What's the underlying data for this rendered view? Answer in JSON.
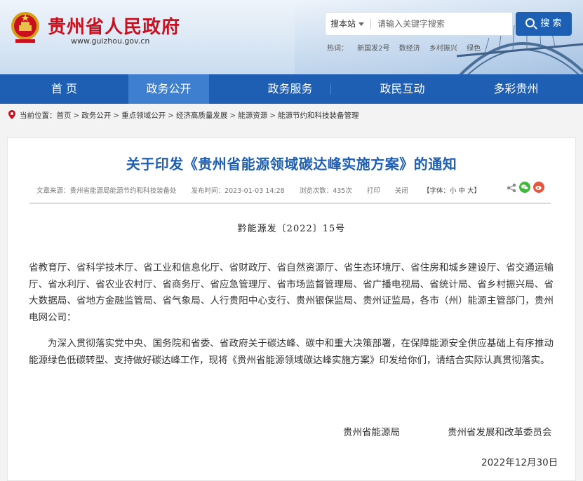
{
  "header": {
    "site_title": "贵州省人民政府",
    "site_url": "www.guizhou.gov.cn",
    "search": {
      "scope_label": "搜本站",
      "placeholder": "请输入关键字搜索",
      "button_label": "搜 索"
    },
    "hotwords": [
      "热词：",
      "新国发2号",
      "数经济",
      "乡村振兴",
      "绿色"
    ]
  },
  "nav": {
    "items": [
      {
        "label": "首 页"
      },
      {
        "label": "政务公开"
      },
      {
        "label": "政务服务"
      },
      {
        "label": "政民互动"
      },
      {
        "label": "多彩贵州"
      }
    ],
    "active_index": 1
  },
  "breadcrumb": {
    "prefix": "当前位置：",
    "items": [
      "首页",
      "政务公开",
      "重点领域公开",
      "经济高质量发展",
      "能源资源",
      "能源节约和科技装备管理"
    ],
    "separator": ">"
  },
  "article": {
    "title": "关于印发《贵州省能源领域碳达峰实施方案》的通知",
    "meta": {
      "source": "文章来源：贵州省能源局能源节约和科技装备处",
      "published": "发布时间：2023-01-03 14:28",
      "views": "浏览次数：435次",
      "print": "打印",
      "close": "关闭",
      "font_size": "【字体：小 中 大】"
    },
    "doc_number": "黔能源发〔2022〕15号",
    "recipients": "省教育厅、省科学技术厅、省工业和信息化厅、省财政厅、省自然资源厅、省生态环境厅、省住房和城乡建设厅、省交通运输厅、省水利厅、省农业农村厅、省商务厅、省应急管理厅、省市场监督管理局、省广播电视局、省统计局、省乡村振兴局、省大数据局、省地方金融监管局、省气象局、人行贵阳中心支行、贵州银保监局、贵州证监局，各市（州）能源主管部门，贵州电网公司：",
    "paragraph": "为深入贯彻落实党中央、国务院和省委、省政府关于碳达峰、碳中和重大决策部署，在保障能源安全供应基础上有序推动能源绿色低碳转型、支持做好碳达峰工作，现将《贵州省能源领域碳达峰实施方案》印发给你们，请结合实际认真贯彻落实。",
    "signatories": [
      "贵州省能源局",
      "贵州省发展和改革委员会"
    ],
    "date": "2022年12月30日"
  },
  "colors": {
    "brand_red": "#c8101f",
    "nav_blue": "#1e5fb4",
    "nav_active": "#3f7fcf",
    "title_blue": "#1e5fb4",
    "wechat_green": "#3fb837",
    "weibo_orange": "#e8553d"
  },
  "icons": [
    "national-emblem-icon",
    "search-icon",
    "location-pin-icon",
    "share-icon",
    "wechat-icon",
    "weibo-icon"
  ]
}
